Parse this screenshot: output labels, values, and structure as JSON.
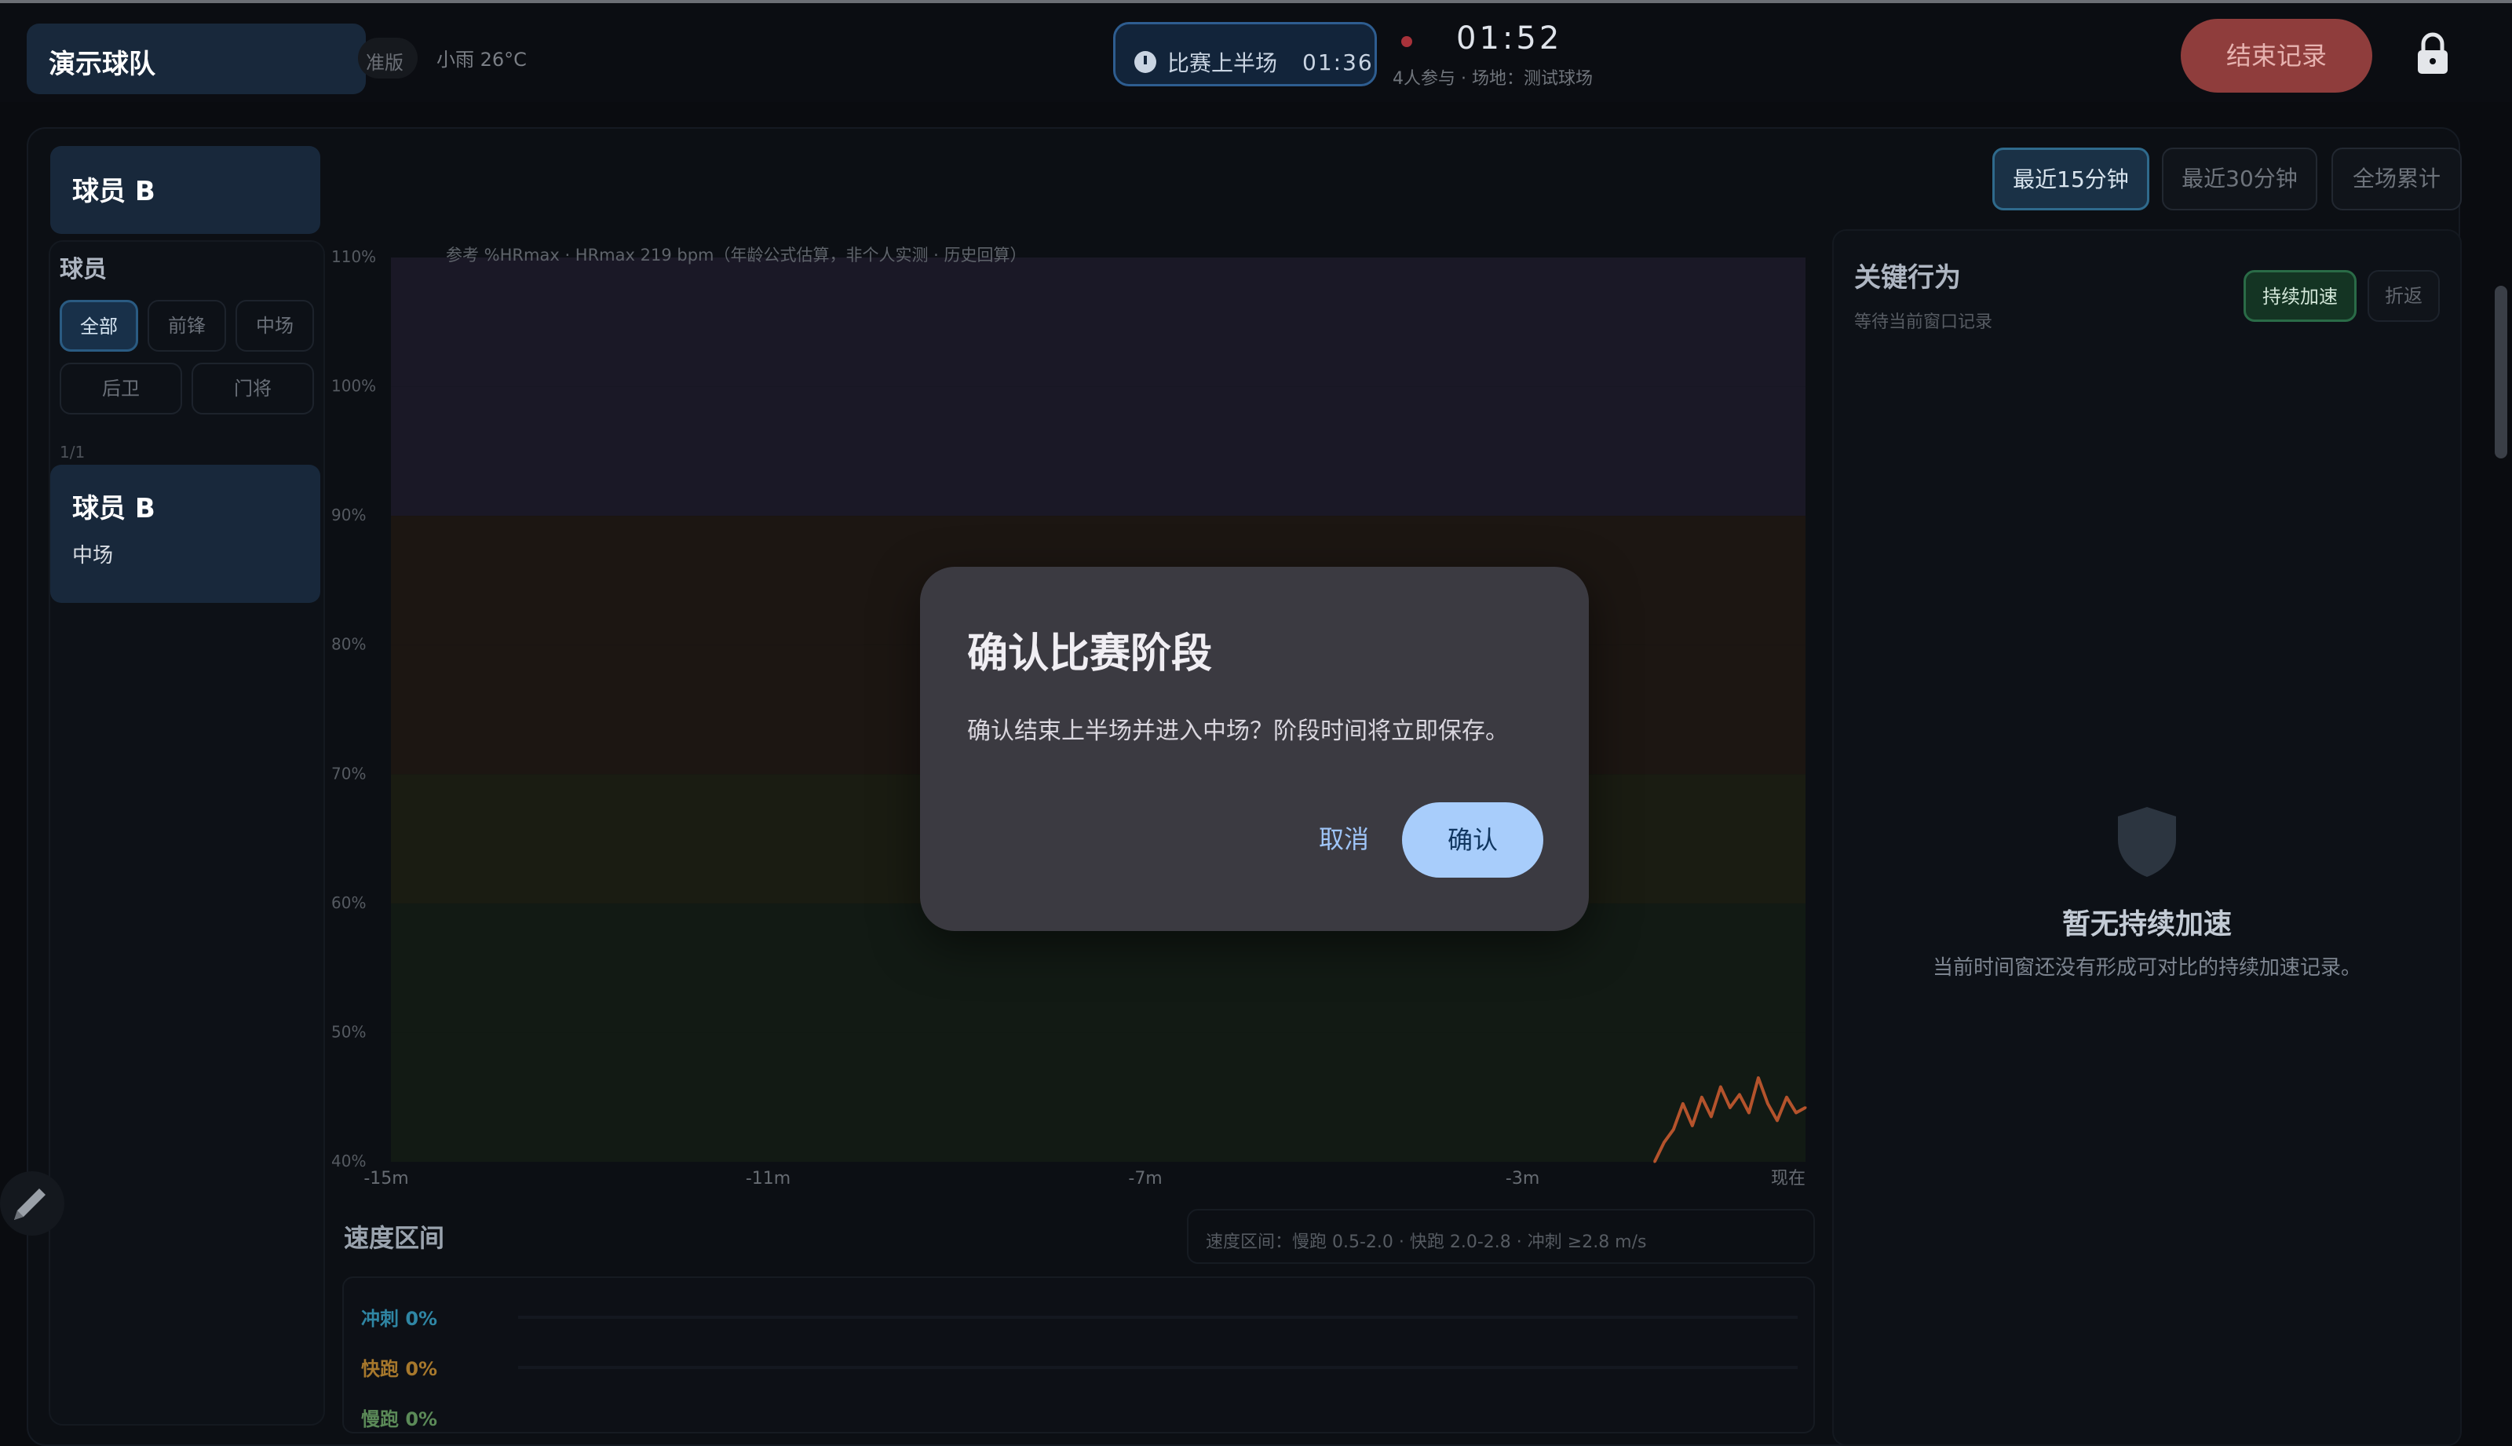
{
  "topbar": {
    "team": "演示球队",
    "mode_tag": "准版",
    "weather": "小雨 26°C",
    "stage_label": "比赛上半场",
    "stage_time": "01:36",
    "clock": "01:52",
    "meta": "4人参与 · 场地：测试球场",
    "end_button": "结束记录"
  },
  "sidebar": {
    "header_player": "球员 B",
    "title": "球员",
    "filters": [
      "全部",
      "前锋",
      "中场",
      "后卫",
      "门将"
    ],
    "active_filter": "全部",
    "page": "1/1",
    "players": [
      {
        "name": "球员 B",
        "position": "中场"
      }
    ]
  },
  "time_tabs": {
    "items": [
      "最近15分钟",
      "最近30分钟",
      "全场累计"
    ],
    "active": "最近15分钟"
  },
  "chart_data": {
    "type": "line",
    "title": "参考 %HRmax · HRmax 219 bpm（年龄公式估算，非个人实测 · 历史回算）",
    "xlabel": "",
    "ylabel": "",
    "x_ticks": [
      "-15m",
      "-11m",
      "-7m",
      "-3m",
      "现在"
    ],
    "y_ticks": [
      "110%",
      "100%",
      "90%",
      "80%",
      "70%",
      "60%",
      "50%",
      "40%"
    ],
    "ylim": [
      40,
      110
    ],
    "xlim": [
      -15,
      0
    ],
    "zones": [
      {
        "from": 100,
        "to": 110,
        "color": "#1a1826"
      },
      {
        "from": 90,
        "to": 100,
        "color": "#1a1826"
      },
      {
        "from": 80,
        "to": 90,
        "color": "#1c1612"
      },
      {
        "from": 70,
        "to": 80,
        "color": "#1c1612"
      },
      {
        "from": 60,
        "to": 70,
        "color": "#1a1c12"
      },
      {
        "from": 50,
        "to": 60,
        "color": "#121a14"
      },
      {
        "from": 40,
        "to": 50,
        "color": "#121a14"
      }
    ],
    "series": [
      {
        "color": "#b4532c",
        "x": [
          -1.6,
          -1.5,
          -1.4,
          -1.3,
          -1.2,
          -1.1,
          -1.0,
          -0.9,
          -0.8,
          -0.7,
          -0.6,
          -0.5,
          -0.4,
          -0.3,
          -0.2,
          -0.1,
          0.0
        ],
        "values": [
          40.0,
          41.5,
          42.5,
          44.5,
          42.8,
          45.0,
          43.5,
          45.8,
          44.2,
          45.2,
          43.8,
          46.5,
          44.5,
          43.2,
          45.0,
          43.8,
          44.2
        ]
      }
    ]
  },
  "speed": {
    "title": "速度区间",
    "legend": "速度区间：慢跑 0.5-2.0 · 快跑 2.0-2.8 · 冲刺 ≥2.8 m/s",
    "rows": [
      {
        "label": "冲刺 0%",
        "color": "#2f86a4"
      },
      {
        "label": "快跑 0%",
        "color": "#a7782c"
      },
      {
        "label": "慢跑 0%",
        "color": "#5b8a58"
      }
    ]
  },
  "key_behavior": {
    "title": "关键行为",
    "subtitle": "等待当前窗口记录",
    "buttons": [
      "持续加速",
      "折返"
    ],
    "active": "持续加速",
    "empty_title": "暂无持续加速",
    "empty_desc": "当前时间窗还没有形成可对比的持续加速记录。"
  },
  "dialog": {
    "title": "确认比赛阶段",
    "message": "确认结束上半场并进入中场？阶段时间将立即保存。",
    "cancel": "取消",
    "confirm": "确认"
  },
  "icons": {
    "timer": "timer-icon",
    "lock": "lock-icon",
    "pencil": "pencil-icon",
    "shield": "shield-icon"
  }
}
